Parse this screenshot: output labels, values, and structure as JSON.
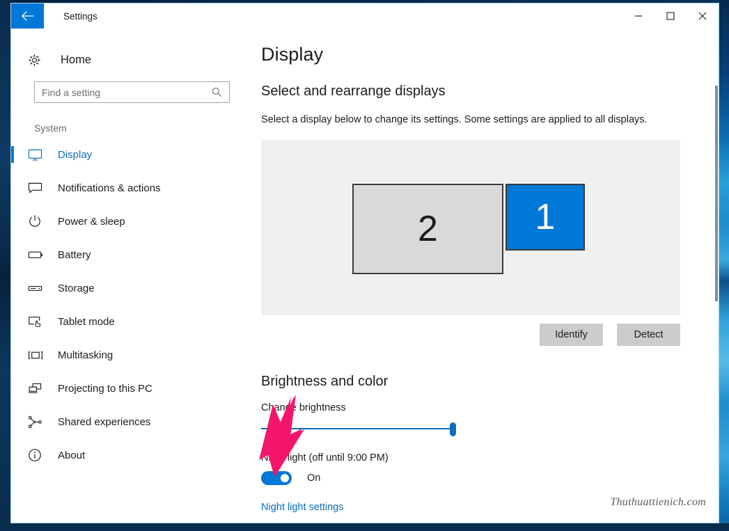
{
  "window": {
    "title": "Settings",
    "back_icon": "back-arrow-icon",
    "minimize_icon": "minimize-icon",
    "maximize_icon": "maximize-icon",
    "close_icon": "close-icon",
    "accent_color": "#0078d7"
  },
  "sidebar": {
    "home": {
      "label": "Home",
      "icon": "gear-icon"
    },
    "search": {
      "placeholder": "Find a setting",
      "value": "",
      "icon": "search-icon"
    },
    "section_label": "System",
    "items": [
      {
        "label": "Display",
        "icon": "monitor-icon",
        "selected": true
      },
      {
        "label": "Notifications & actions",
        "icon": "speech-bubble-icon",
        "selected": false
      },
      {
        "label": "Power & sleep",
        "icon": "power-icon",
        "selected": false
      },
      {
        "label": "Battery",
        "icon": "battery-icon",
        "selected": false
      },
      {
        "label": "Storage",
        "icon": "storage-icon",
        "selected": false
      },
      {
        "label": "Tablet mode",
        "icon": "tablet-mode-icon",
        "selected": false
      },
      {
        "label": "Multitasking",
        "icon": "multitasking-icon",
        "selected": false
      },
      {
        "label": "Projecting to this PC",
        "icon": "projecting-icon",
        "selected": false
      },
      {
        "label": "Shared experiences",
        "icon": "shared-experiences-icon",
        "selected": false
      },
      {
        "label": "About",
        "icon": "info-icon",
        "selected": false
      }
    ]
  },
  "main": {
    "page_title": "Display",
    "arrange_section": {
      "title": "Select and rearrange displays",
      "description": "Select a display below to change its settings. Some settings are applied to all displays.",
      "monitors": [
        {
          "number": "2",
          "selected": false
        },
        {
          "number": "1",
          "selected": true
        }
      ],
      "identify_button": "Identify",
      "detect_button": "Detect"
    },
    "brightness_section": {
      "title": "Brightness and color",
      "brightness_label": "Change brightness",
      "brightness_value": 96,
      "nightlight_label": "Night light (off until 9:00 PM)",
      "nightlight_state": "On",
      "nightlight_link": "Night light settings"
    }
  },
  "annotation": {
    "arrow_color": "#f4156c",
    "arrow_target": "night-light-toggle"
  },
  "watermark": {
    "text": "Thuthuattienich.com"
  }
}
